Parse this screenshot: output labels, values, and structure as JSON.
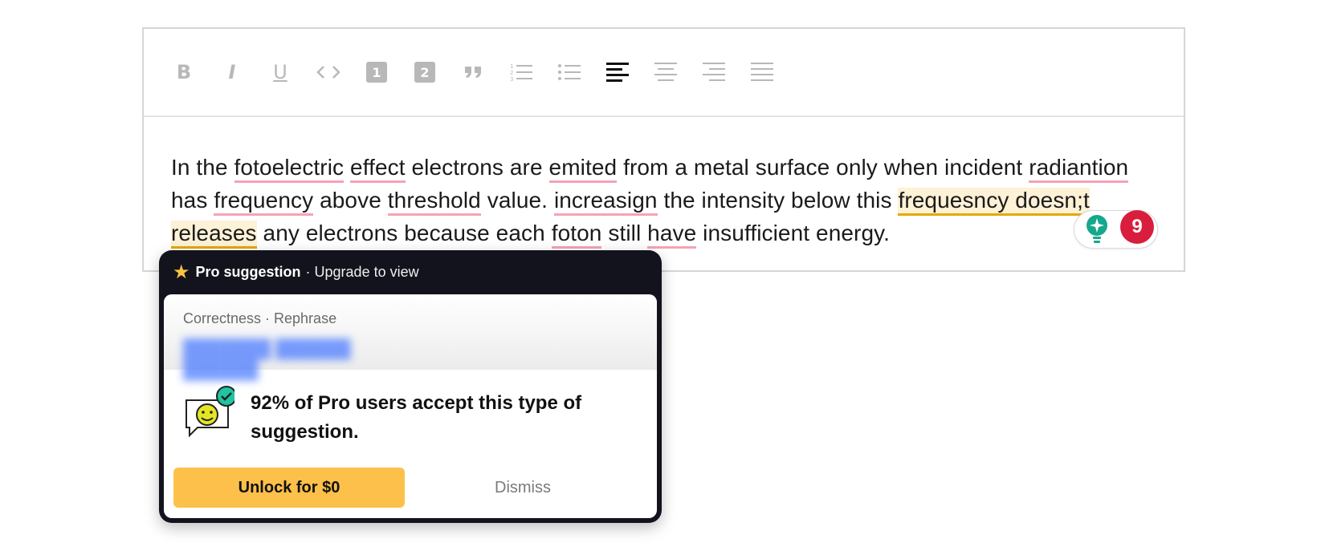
{
  "toolbar": {
    "buttons": [
      {
        "name": "bold-button",
        "icon": "bold-icon",
        "glyph": "B"
      },
      {
        "name": "italic-button",
        "icon": "italic-icon",
        "glyph": "I"
      },
      {
        "name": "underline-button",
        "icon": "underline-icon",
        "glyph": "U"
      },
      {
        "name": "code-button",
        "icon": "code-icon"
      },
      {
        "name": "heading-1-button",
        "icon": "heading-1-icon",
        "glyph": "1"
      },
      {
        "name": "heading-2-button",
        "icon": "heading-2-icon",
        "glyph": "2"
      },
      {
        "name": "quote-button",
        "icon": "quote-icon"
      },
      {
        "name": "ordered-list-button",
        "icon": "ordered-list-icon"
      },
      {
        "name": "bullet-list-button",
        "icon": "bullet-list-icon"
      },
      {
        "name": "align-left-button",
        "icon": "align-left-icon",
        "active": true
      },
      {
        "name": "align-center-button",
        "icon": "align-center-icon"
      },
      {
        "name": "align-right-button",
        "icon": "align-right-icon"
      },
      {
        "name": "align-justify-button",
        "icon": "align-justify-icon"
      }
    ]
  },
  "document": {
    "segments": [
      {
        "text": "In the ",
        "mark": "none"
      },
      {
        "text": "fotoelectric",
        "mark": "error"
      },
      {
        "text": " ",
        "mark": "none"
      },
      {
        "text": "effect",
        "mark": "error"
      },
      {
        "text": " electrons are ",
        "mark": "none"
      },
      {
        "text": "emited",
        "mark": "error"
      },
      {
        "text": " from a metal surface only when incident ",
        "mark": "none"
      },
      {
        "text": "radiantion",
        "mark": "error"
      },
      {
        "text": " has ",
        "mark": "none"
      },
      {
        "text": "frequency",
        "mark": "error"
      },
      {
        "text": " above ",
        "mark": "none"
      },
      {
        "text": "threshold",
        "mark": "error"
      },
      {
        "text": " value. ",
        "mark": "none"
      },
      {
        "text": "increasign",
        "mark": "error"
      },
      {
        "text": " the intensity below this ",
        "mark": "none"
      },
      {
        "text": "frequesncy doesn;t releases",
        "mark": "pro"
      },
      {
        "text": " any electrons because each ",
        "mark": "none"
      },
      {
        "text": "foton",
        "mark": "error"
      },
      {
        "text": " still ",
        "mark": "none"
      },
      {
        "text": "have",
        "mark": "error"
      },
      {
        "text": " insufficient energy.",
        "mark": "none"
      }
    ]
  },
  "assistant": {
    "icon": "lightbulb-icon",
    "issue_count": "9",
    "colors": {
      "bulb": "#15a88c",
      "badge": "#d81e3c"
    }
  },
  "popup": {
    "header_title": "Pro suggestion",
    "header_subtitle": "· Upgrade to view",
    "category": "Correctness · Rephrase",
    "stat_text": "92% of Pro users accept this type of suggestion.",
    "unlock_label": "Unlock for $0",
    "dismiss_label": "Dismiss",
    "colors": {
      "header_bg": "#12131c",
      "unlock_bg": "#fdc04a",
      "star": "#f6c343"
    }
  }
}
